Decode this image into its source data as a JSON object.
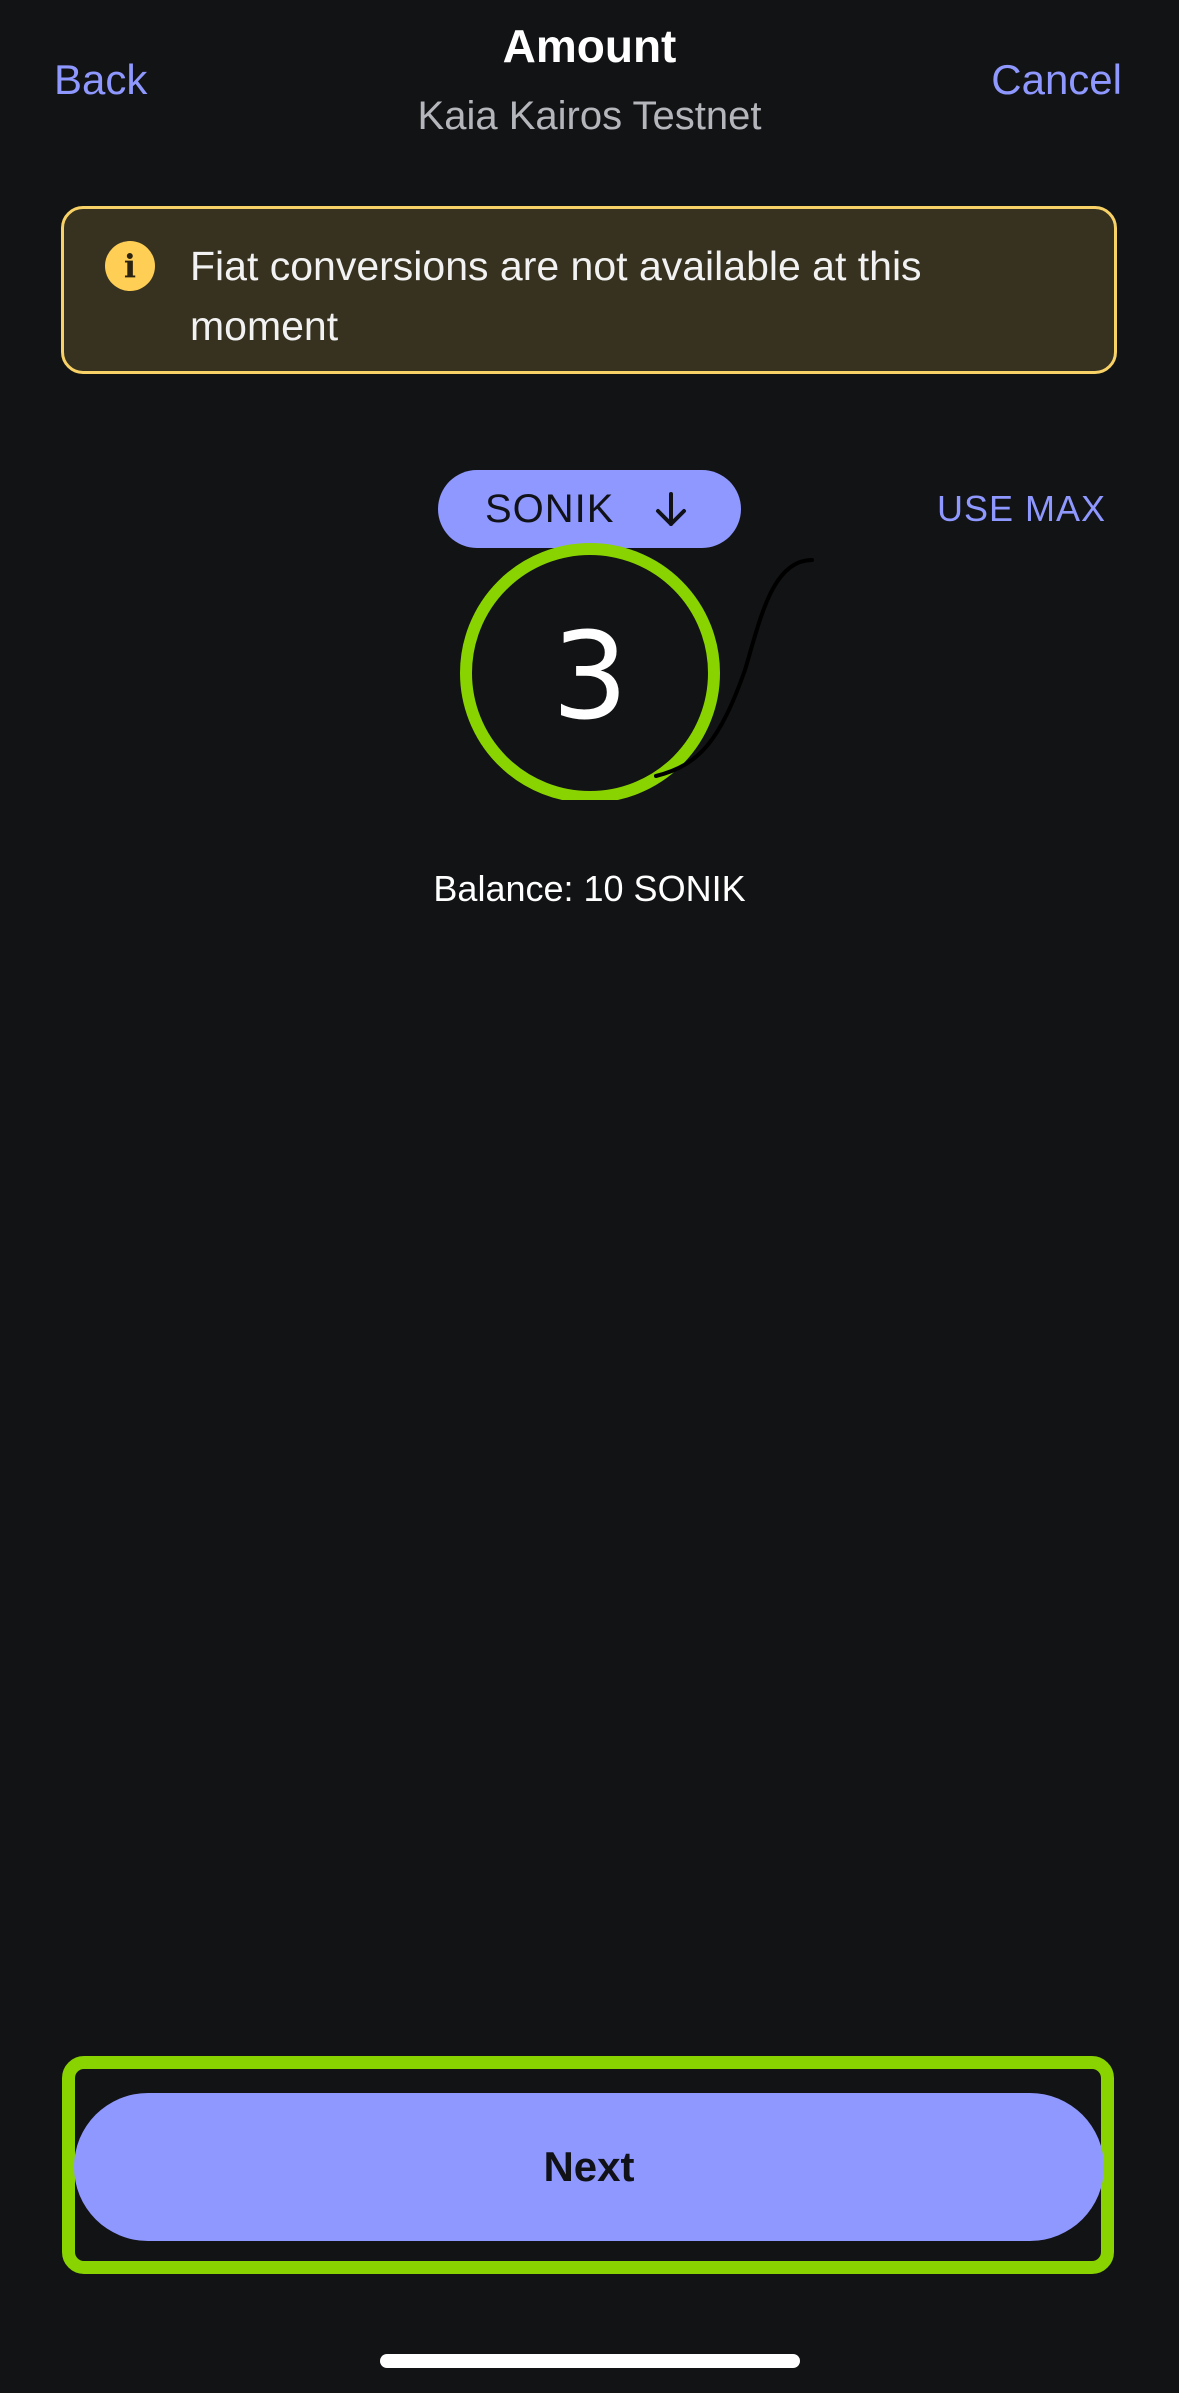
{
  "header": {
    "back_label": "Back",
    "cancel_label": "Cancel",
    "title": "Amount",
    "subtitle": "Kaia Kairos Testnet"
  },
  "banner": {
    "icon": "info-icon",
    "icon_glyph": "i",
    "text": "Fiat conversions are not available at this moment",
    "border_color": "#f8d266",
    "background_color": "#373220"
  },
  "token": {
    "symbol": "SONIK",
    "toggle_icon": "arrow-down-icon"
  },
  "use_max_label": "USE MAX",
  "amount": {
    "value": "3"
  },
  "balance_text": "Balance: 10 SONIK",
  "next_label": "Next",
  "colors": {
    "accent": "#8f98ff",
    "background": "#121314",
    "highlight_annotation": "#88d300"
  }
}
